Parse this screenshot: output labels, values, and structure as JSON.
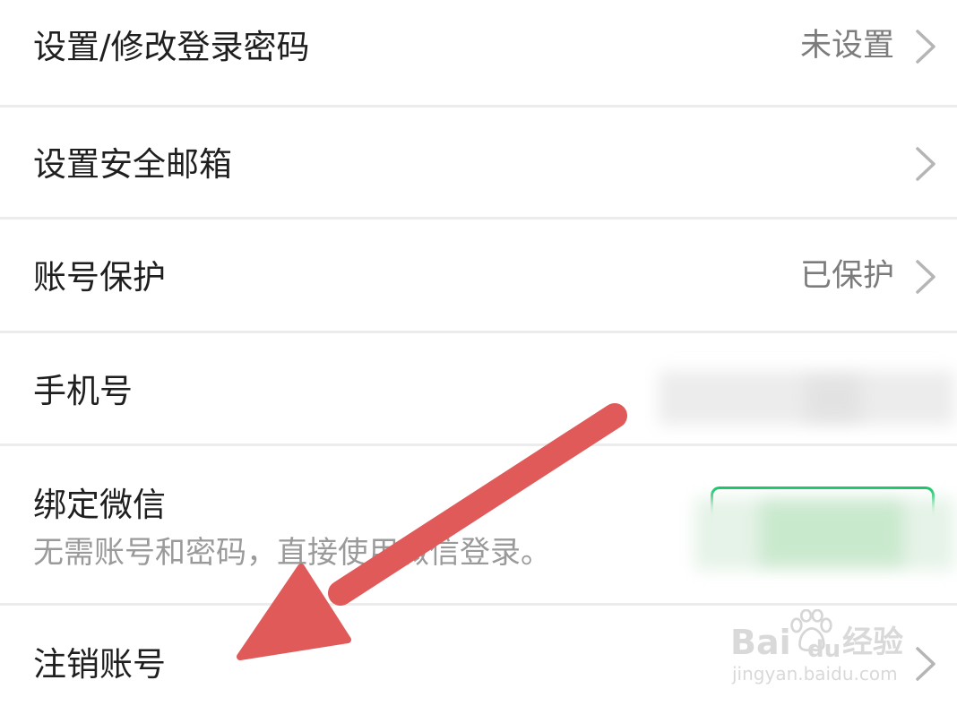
{
  "settings": {
    "rows": [
      {
        "title": "设置/修改登录密码",
        "value": "未设置"
      },
      {
        "title": "设置安全邮箱",
        "value": ""
      },
      {
        "title": "账号保护",
        "value": "已保护"
      },
      {
        "title": "手机号",
        "value": ""
      },
      {
        "title": "绑定微信",
        "subtitle": "无需账号和密码，直接使用微信登录。"
      },
      {
        "title": "注销账号",
        "value": ""
      }
    ]
  },
  "annotation": {
    "arrow_color": "#e05a5a"
  },
  "watermark": {
    "brand": "Bai",
    "brand2": "du",
    "product": "经验",
    "domain": "jingyan.baidu.com"
  },
  "colors": {
    "title_text": "#1f1f1f",
    "value_text": "#7c7c7c",
    "subtitle_text": "#9a9a9a",
    "divider": "#ececec",
    "chevron": "#b5b5b5",
    "wechat_green": "#07c160"
  }
}
